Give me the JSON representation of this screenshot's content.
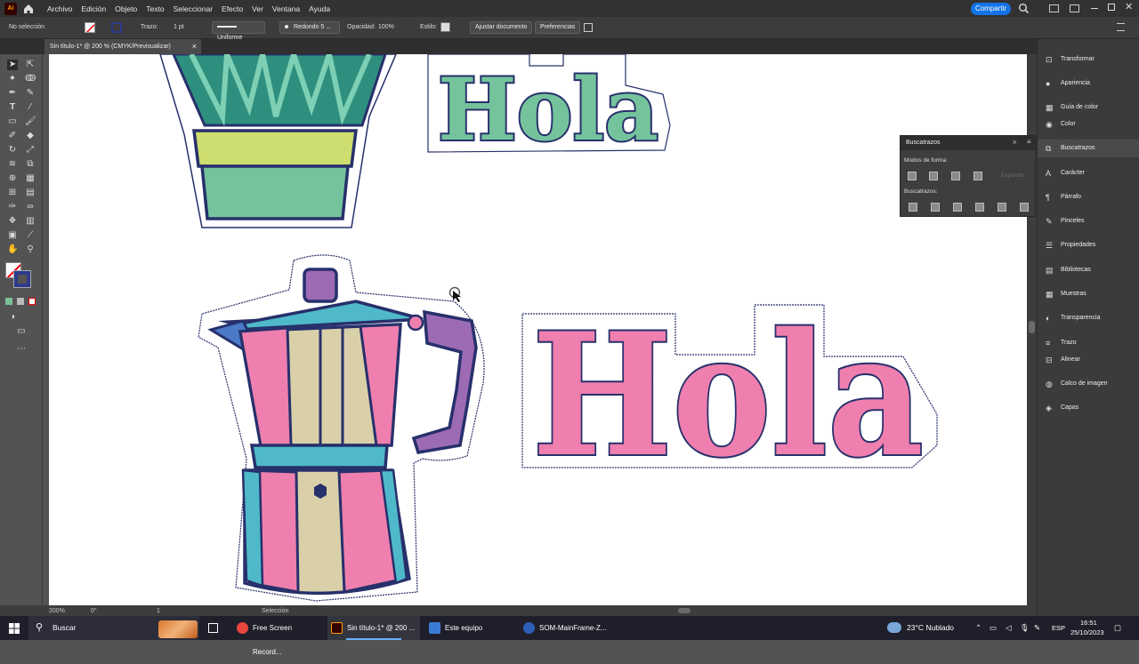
{
  "menu": {
    "app_logo": "Ai",
    "items": [
      "Archivo",
      "Edición",
      "Objeto",
      "Texto",
      "Seleccionar",
      "Efecto",
      "Ver",
      "Ventana",
      "Ayuda"
    ],
    "share_label": "Compartir"
  },
  "control_bar": {
    "selection_status": "No selección",
    "stroke_label": "Trazo:",
    "stroke_weight": "1 pt",
    "stroke_profile": "Uniforme",
    "brush": "Redondo 5 ...",
    "opacity_label": "Opacidad:",
    "opacity_value": "100%",
    "style_label": "Estilo:",
    "document_setup": "Ajustar documento",
    "preferences": "Preferencias"
  },
  "document_tab": {
    "title": "Sin título-1* @ 200 % (CMYK/Previsualizar)",
    "close": "×"
  },
  "artwork": {
    "text_top": "Hola",
    "text_main": "Hola"
  },
  "pathfinder": {
    "title": "Buscatrazos",
    "shape_modes_label": "Modos de forma:",
    "expand_label": "Expandir",
    "pathfinders_label": "Buscatrazos:"
  },
  "right_panels": [
    {
      "label": "Transformar",
      "icon": "transform-icon"
    },
    {
      "label": "Apariencia",
      "icon": "appearance-icon"
    },
    {
      "label": "Guía de color",
      "icon": "color-guide-icon"
    },
    {
      "label": "Color",
      "icon": "color-icon"
    },
    {
      "label": "Buscatrazos",
      "icon": "pathfinder-icon"
    },
    {
      "label": "Carácter",
      "icon": "character-icon"
    },
    {
      "label": "Párrafo",
      "icon": "paragraph-icon"
    },
    {
      "label": "Pinceles",
      "icon": "brushes-icon"
    },
    {
      "label": "Propiedades",
      "icon": "properties-icon"
    },
    {
      "label": "Bibliotecas",
      "icon": "libraries-icon"
    },
    {
      "label": "Muestras",
      "icon": "swatches-icon"
    },
    {
      "label": "Transparencia",
      "icon": "transparency-icon"
    },
    {
      "label": "Trazo",
      "icon": "stroke-icon"
    },
    {
      "label": "Alinear",
      "icon": "align-icon"
    },
    {
      "label": "Calco de imagen",
      "icon": "image-trace-icon"
    },
    {
      "label": "Capas",
      "icon": "layers-icon"
    }
  ],
  "status_bar": {
    "zoom": "200%",
    "rotation": "0°",
    "artboard": "1",
    "tool": "Selección"
  },
  "taskbar": {
    "search": "Buscar",
    "apps": [
      {
        "label": "Free Screen Record...",
        "color": "#e8453c"
      },
      {
        "label": "Sin título-1* @ 200 ...",
        "color": "#330000"
      },
      {
        "label": "Este equipo",
        "color": "#3a7bd5"
      },
      {
        "label": "SOM-MainFrame-Z...",
        "color": "#2d5fb8"
      }
    ],
    "weather": "23°C  Nublado",
    "lang": "ESP",
    "time": "16:51",
    "date": "25/10/2023"
  },
  "colors": {
    "pink": "#ef7fae",
    "navy": "#27306b",
    "teal": "#4fb9c9",
    "mint": "#74c39c",
    "beige": "#d9d0aa",
    "purple": "#9c6bb4",
    "lime": "#cedd6f",
    "green_dark": "#2f8f7f"
  }
}
